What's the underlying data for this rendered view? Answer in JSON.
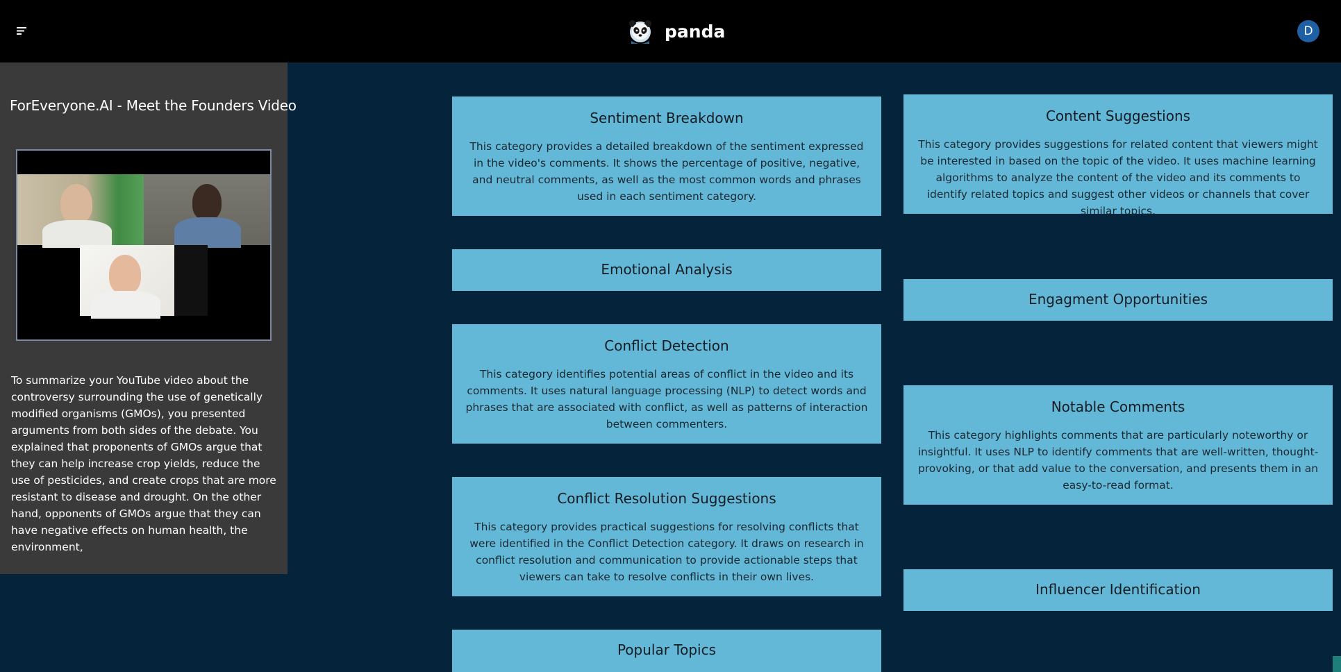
{
  "header": {
    "title": "panda",
    "menu_icon": "hamburger-icon",
    "logo_icon": "panda-logo",
    "avatar_initial": "D"
  },
  "sidebar": {
    "video_title": "ForEveryone.AI - Meet the Founders Video",
    "summary": "To summarize your YouTube video about the controversy surrounding the use of genetically modified organisms (GMOs), you presented arguments from both sides of the debate. You explained that proponents of GMOs argue that they can help increase crop yields, reduce the use of pesticides, and create crops that are more resistant to disease and drought. On the other hand, opponents of GMOs argue that they can have negative effects on human health, the environment,"
  },
  "cards_left": [
    {
      "title": "Sentiment Breakdown",
      "body": "This category provides a detailed breakdown of the sentiment expressed in the video's comments. It shows the percentage of positive, negative, and neutral comments, as well as the most common words and phrases used in each sentiment category."
    },
    {
      "title": "Emotional Analysis",
      "body": ""
    },
    {
      "title": "Conflict Detection",
      "body": "This category identifies potential areas of conflict in the video and its comments. It uses natural language processing (NLP) to detect words and phrases that are associated with conflict, as well as patterns of interaction between commenters."
    },
    {
      "title": "Conflict Resolution Suggestions",
      "body": "This category provides practical suggestions for resolving conflicts that were identified in the Conflict Detection category. It draws on research in conflict resolution and communication to provide actionable steps that viewers can take to resolve conflicts in their own lives."
    },
    {
      "title": "Popular Topics",
      "body": ""
    }
  ],
  "cards_right": [
    {
      "title": "Content Suggestions",
      "body": "This category provides suggestions for related content that viewers might be interested in based on the topic of the video. It uses machine learning algorithms to analyze the content of the video and its comments to identify related topics and suggest other videos or channels that cover similar topics."
    },
    {
      "title": "Engagment Opportunities",
      "body": ""
    },
    {
      "title": "Notable Comments",
      "body": "This category highlights comments that are particularly noteworthy or insightful. It uses NLP to identify comments that are well-written, thought-provoking, or that add value to the conversation, and presents them in an easy-to-read format."
    },
    {
      "title": "Influencer Identification",
      "body": ""
    }
  ],
  "colors": {
    "background": "#05233b",
    "header": "#000000",
    "sidebar": "#3a3a3a",
    "card": "#64b8d7",
    "avatar": "#1f5fa3"
  }
}
